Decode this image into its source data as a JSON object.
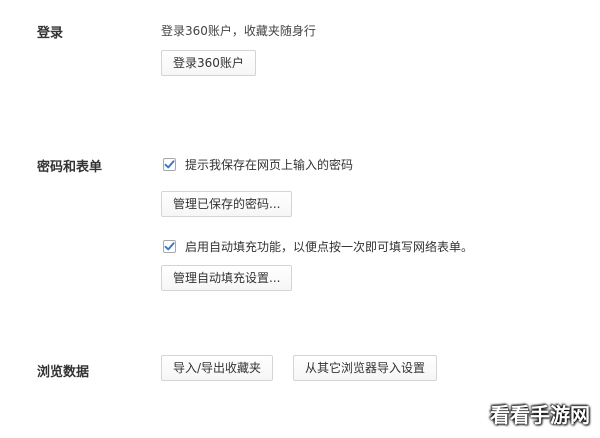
{
  "login": {
    "label": "登录",
    "description": "登录360账户，收藏夹随身行",
    "button": "登录360账户"
  },
  "passwords_forms": {
    "label": "密码和表单",
    "save_password": {
      "label": "提示我保存在网页上输入的密码",
      "checked": true
    },
    "manage_passwords_button": "管理已保存的密码...",
    "autofill": {
      "label": "启用自动填充功能，以便点按一次即可填写网络表单。",
      "checked": true
    },
    "manage_autofill_button": "管理自动填充设置..."
  },
  "browsing_data": {
    "label": "浏览数据",
    "import_export_button": "导入/导出收藏夹",
    "import_other_button": "从其它浏览器导入设置"
  },
  "watermark": "看看手游网",
  "colors": {
    "checkmark": "#3a78c4",
    "border": "#d4d4d4"
  },
  "icons": {
    "checkbox_check": "check-icon"
  }
}
